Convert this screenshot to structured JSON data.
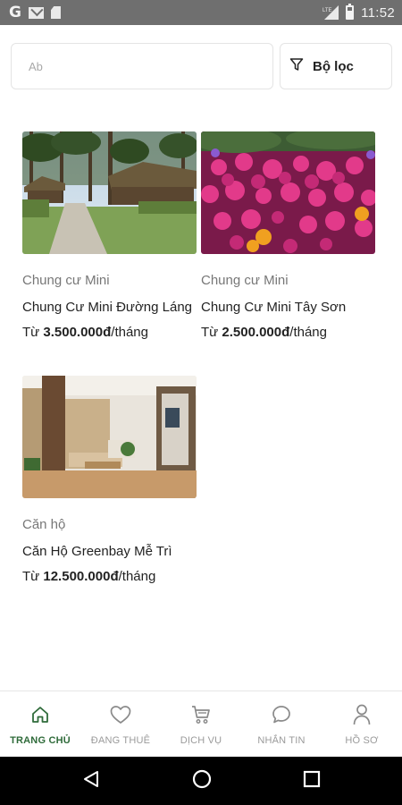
{
  "status_bar": {
    "time": "11:52",
    "network_label": "LTE",
    "icons": [
      "google-icon",
      "gmail-icon",
      "sd-card-icon",
      "signal-icon",
      "battery-icon"
    ]
  },
  "search": {
    "placeholder": "Ab",
    "value": ""
  },
  "filter": {
    "label": "Bộ lọc",
    "icon": "filter-icon"
  },
  "listings": [
    {
      "category": "Chung cư Mini",
      "name": "Chung Cư Mini Đường Láng",
      "price_prefix": "Từ ",
      "price": "3.500.000đ",
      "price_unit": "/tháng",
      "image": "pine-forest-cabin-photo"
    },
    {
      "category": "Chung cư Mini",
      "name": "Chung Cư Mini Tây Sơn",
      "price_prefix": "Từ ",
      "price": "2.500.000đ",
      "price_unit": "/tháng",
      "image": "pink-flowers-photo"
    },
    {
      "category": "Căn hộ",
      "name": "Căn Hộ Greenbay Mễ Trì",
      "price_prefix": "Từ ",
      "price": "12.500.000đ",
      "price_unit": "/tháng",
      "image": "living-room-photo"
    }
  ],
  "bottom_nav": {
    "items": [
      {
        "label": "TRANG CHỦ",
        "icon": "home-icon",
        "active": true
      },
      {
        "label": "ĐANG THUÊ",
        "icon": "heart-icon",
        "active": false
      },
      {
        "label": "DỊCH VỤ",
        "icon": "cart-icon",
        "active": false
      },
      {
        "label": "NHẮN TIN",
        "icon": "chat-icon",
        "active": false
      },
      {
        "label": "HỒ SƠ",
        "icon": "person-icon",
        "active": false
      }
    ]
  },
  "colors": {
    "accent": "#2f6b3a",
    "inactive": "#9a9a9a",
    "status_bar": "#6f6f6f"
  }
}
